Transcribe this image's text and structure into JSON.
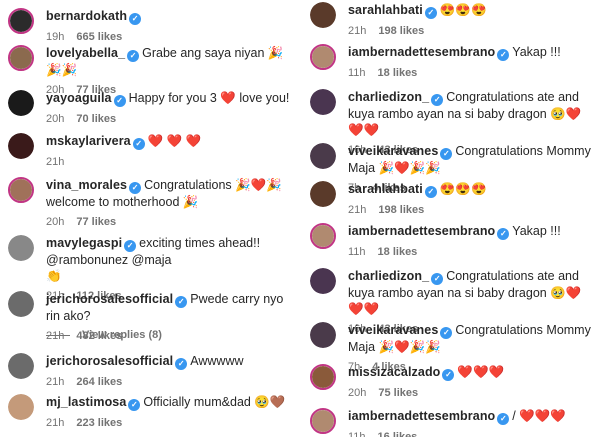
{
  "left": [
    {
      "user": "bernardokath",
      "text": "",
      "time": "19h",
      "likes": "665 likes",
      "avatar_color": "#2b2b2b",
      "ring": true
    },
    {
      "user": "lovelyabella_",
      "text": "Grabe ang saya niyan 🎉🎉🎉",
      "time": "20h",
      "likes": "77 likes",
      "avatar_color": "#8b6a4e",
      "ring": true
    },
    {
      "user": "yayoaguila",
      "text": "Happy for you 3 ❤️ love you!",
      "time": "20h",
      "likes": "70 likes",
      "avatar_color": "#1a1a1a",
      "ring": false
    },
    {
      "user": "mskaylarivera",
      "text": "❤️ ❤️ ❤️",
      "time": "21h",
      "likes": "",
      "avatar_color": "#3a1a1a",
      "ring": false
    },
    {
      "user": "vina_morales",
      "text": "Congratulations 🎉❤️🎉 welcome to motherhood 🎉",
      "time": "20h",
      "likes": "77 likes",
      "avatar_color": "#a0715a",
      "ring": true
    },
    {
      "user": "mavylegaspi",
      "text": "exciting times ahead!! @rambonunez @maja",
      "text_extra": "👏",
      "time": "21h",
      "likes": "112 likes",
      "avatar_color": "#888888",
      "ring": false
    },
    {
      "user": "jerichorosalesofficial",
      "text": "Pwede carry nyo rin ako?",
      "time": "21h",
      "likes": "482 likes",
      "extra": "Reply",
      "avatar_color": "#6b6b6b",
      "ring": false
    },
    {
      "user": "jerichorosalesofficial",
      "text": "Awwwww",
      "time": "21h",
      "likes": "264 likes",
      "avatar_color": "#6b6b6b",
      "ring": false
    },
    {
      "user": "mj_lastimosa",
      "text": "Officially mum&dad 🥹🤎",
      "time": "21h",
      "likes": "223 likes",
      "avatar_color": "#c49a7a",
      "ring": false
    }
  ],
  "left_replies": "View replies (8)",
  "right": [
    {
      "user": "sarahlahbati",
      "text": "😍😍😍",
      "time": "21h",
      "likes": "198 likes",
      "avatar_color": "#5a3a2a",
      "ring": false
    },
    {
      "user": "iambernadettesembrano",
      "text": "Yakap !!!",
      "time": "11h",
      "likes": "18 likes",
      "avatar_color": "#b08a70",
      "ring": true
    },
    {
      "user": "charliedizon_",
      "text": "Congratulations ate and kuya rambo ayan na si baby dragon 🥹❤️❤️❤️",
      "time": "16h",
      "likes": "43 likes",
      "avatar_color": "#4a3550",
      "ring": false
    },
    {
      "user": "viveikaravanes",
      "text": "Congratulations Mommy Maja 🎉❤️🎉🎉",
      "time": "7h",
      "likes": "4 likes",
      "avatar_color": "#4a3a4a",
      "ring": false
    },
    {
      "user": "sarahlahbati",
      "text": "😍😍😍",
      "time": "21h",
      "likes": "198 likes",
      "avatar_color": "#5a3a2a",
      "ring": false
    },
    {
      "user": "iambernadettesembrano",
      "text": "Yakap !!!",
      "time": "11h",
      "likes": "18 likes",
      "avatar_color": "#b08a70",
      "ring": true
    },
    {
      "user": "charliedizon_",
      "text": "Congratulations ate and kuya rambo ayan na si baby dragon 🥹❤️❤️❤️",
      "time": "16h",
      "likes": "43 likes",
      "avatar_color": "#4a3550",
      "ring": false
    },
    {
      "user": "viveikaravanes",
      "text": "Congratulations Mommy Maja 🎉❤️🎉🎉",
      "time": "7h",
      "likes": "4 likes",
      "avatar_color": "#4a3a4a",
      "ring": false
    },
    {
      "user": "missizacalzado",
      "text": "❤️❤️❤️",
      "time": "20h",
      "likes": "75 likes",
      "avatar_color": "#8a5a3a",
      "ring": true
    },
    {
      "user": "iambernadettesembrano",
      "text": "/ ❤️❤️❤️",
      "time": "11h",
      "likes": "16 likes",
      "avatar_color": "#b08a70",
      "ring": true
    }
  ],
  "colors": {
    "verified": "#3897f0",
    "ring": "#c13584",
    "meta": "#737373",
    "mention": "#00376b"
  }
}
